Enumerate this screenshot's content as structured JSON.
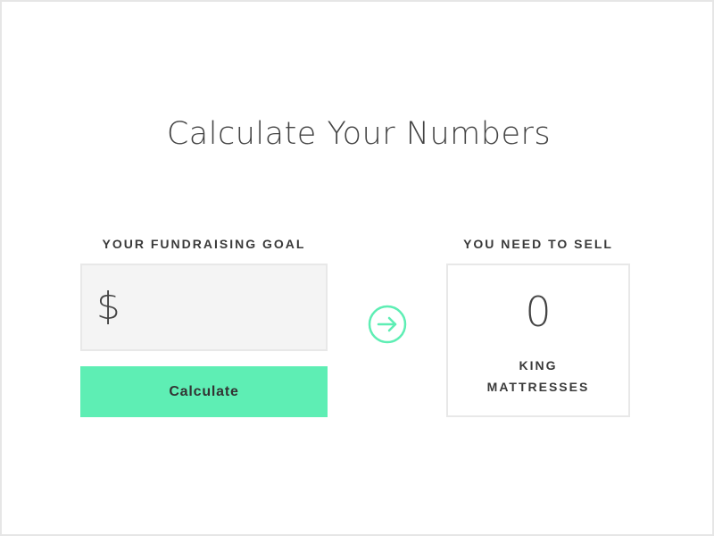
{
  "page": {
    "title": "Calculate Your Numbers"
  },
  "goal": {
    "label": "YOUR FUNDRAISING GOAL",
    "currency_symbol": "$",
    "value": "",
    "placeholder": ""
  },
  "calculate_button": {
    "label": "Calculate"
  },
  "result": {
    "label": "YOU NEED TO SELL",
    "value": "0",
    "unit_line1": "KING",
    "unit_line2": "MATTRESSES"
  },
  "icons": {
    "arrow": "arrow-right-circle-icon"
  },
  "colors": {
    "accent": "#5eeeb4",
    "input_bg": "#f4f4f4",
    "border": "#e8e8e8",
    "text": "#444444"
  }
}
